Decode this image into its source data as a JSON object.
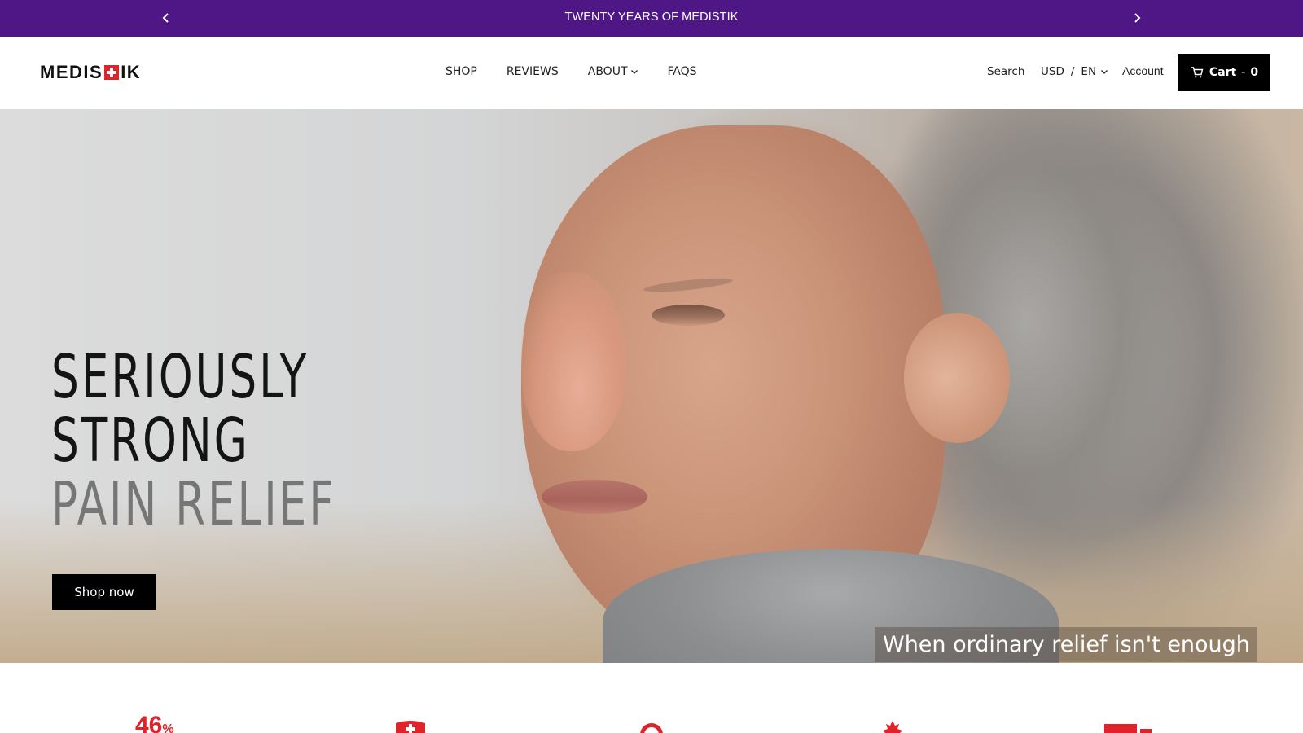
{
  "announcement": {
    "message": "TWENTY YEARS OF MEDISTIK",
    "prev_icon": "chevron-left-icon",
    "next_icon": "chevron-right-icon",
    "background": "#4e1785"
  },
  "header": {
    "logo_text_left": "MEDIS",
    "logo_text_right": "IK",
    "logo_icon": "red-cross-icon",
    "nav": [
      {
        "label": "SHOP"
      },
      {
        "label": "REVIEWS"
      },
      {
        "label": "ABOUT",
        "has_dropdown": true
      },
      {
        "label": "FAQS"
      }
    ],
    "search_label": "Search",
    "currency": "USD",
    "locale_separator": "/",
    "language": "EN",
    "account_label": "Account",
    "cart_label": "Cart",
    "cart_separator": "-",
    "cart_count": "0"
  },
  "hero": {
    "title_line1": "SERIOUSLY",
    "title_line2": "STRONG",
    "title_line3": "PAIN RELIEF",
    "cta_label": "Shop now",
    "tagline": "When ordinary relief isn't enough"
  },
  "features": {
    "stat_value": "46",
    "stat_unit": "%",
    "icons": [
      "shield-cross-icon",
      "badge-icon",
      "maple-leaf-icon",
      "truck-icon"
    ],
    "accent": "#e0222a"
  }
}
